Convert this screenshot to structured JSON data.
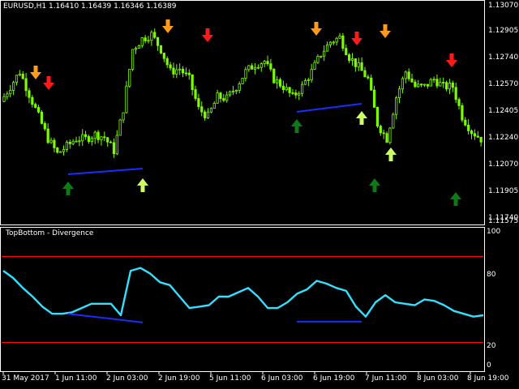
{
  "main_chart": {
    "title": "EURUSD,H1  1.16410 1.16439 1.16346 1.16389",
    "price_scale": [
      "1.13070",
      "1.12905",
      "1.12740",
      "1.12570",
      "1.12405",
      "1.12240",
      "1.12070",
      "1.11905",
      "1.11740",
      "1.11575"
    ],
    "price_min": 1.11575,
    "price_max": 1.1307
  },
  "indicator": {
    "title": "TopBottom - Divergence",
    "levels": [
      "100",
      "80",
      "20",
      "0"
    ],
    "upper_level": 80,
    "lower_level": 20
  },
  "time_axis": [
    "31 May 2017",
    "1 Jun 11:00",
    "2 Jun 03:00",
    "2 Jun 19:00",
    "5 Jun 11:00",
    "6 Jun 03:00",
    "6 Jun 19:00",
    "7 Jun 11:00",
    "8 Jun 03:00",
    "8 Jun 19:00"
  ],
  "colors": {
    "background": "#000000",
    "candle": "#7cfc00",
    "oscillator": "#33e0ff",
    "level_line": "#ff0000",
    "divergence_line": "#1a2cff",
    "top_arrow_orange": "#ff9a1a",
    "top_arrow_red": "#ff1a1a",
    "bottom_arrow_green": "#0d7a14",
    "bottom_arrow_lime": "#ccff66"
  },
  "chart_data": {
    "type": "line",
    "series": [
      {
        "values": [
          1.124,
          1.125,
          1.126,
          1.1245,
          1.123,
          1.1215,
          1.1205,
          1.121,
          1.1215,
          1.1215,
          1.1218,
          1.1216,
          1.1207,
          1.1235,
          1.1275,
          1.1282,
          1.1285,
          1.1275,
          1.126,
          1.1262,
          1.1255,
          1.1235,
          1.123,
          1.1243,
          1.1242,
          1.125,
          1.126,
          1.1265,
          1.1267,
          1.1255,
          1.125,
          1.1243,
          1.125,
          1.126,
          1.1272,
          1.128,
          1.1283,
          1.127,
          1.1263,
          1.1255,
          1.1225,
          1.1215,
          1.1243,
          1.126,
          1.125,
          1.125,
          1.1255,
          1.125,
          1.125,
          1.123,
          1.122,
          1.1215
        ]
      },
      {
        "values": [
          70,
          65,
          58,
          52,
          45,
          40,
          40,
          41,
          44,
          47,
          47,
          47,
          39,
          70,
          72,
          68,
          62,
          60,
          52,
          44,
          45,
          46,
          52,
          52,
          55,
          58,
          52,
          44,
          44,
          48,
          54,
          57,
          63,
          61,
          58,
          56,
          45,
          38,
          48,
          53,
          48,
          47,
          46,
          50,
          49,
          46,
          42,
          40,
          38,
          39
        ]
      }
    ],
    "markers": {
      "top_orange": [
        "1 Jun 03:00",
        "2 Jun 11:00",
        "6 Jun 15:00",
        "7 Jun 07:00"
      ],
      "top_red": [
        "1 Jun 07:00",
        "5 Jun 03:00",
        "7 Jun 03:00",
        "8 Jun 11:00"
      ],
      "bottom_green": [
        "1 Jun 11:00",
        "6 Jun 03:00",
        "7 Jun 11:00",
        "8 Jun 15:00"
      ],
      "bottom_lime": [
        "2 Jun 15:00",
        "6 Jun 23:00",
        "7 Jun 19:00"
      ]
    }
  }
}
